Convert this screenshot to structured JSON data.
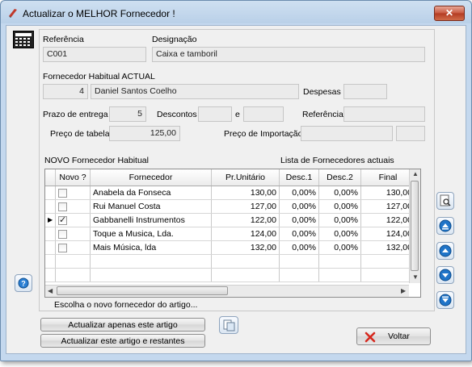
{
  "window": {
    "title": "Actualizar o MELHOR Fornecedor !",
    "close_label": "✕"
  },
  "form": {
    "referencia_label": "Referência",
    "referencia_value": "C001",
    "designacao_label": "Designação",
    "designacao_value": "Caixa e tamboril",
    "fornecedor_habitual_label": "Fornecedor Habitual ACTUAL",
    "fornecedor_num": "4",
    "fornecedor_nome": "Daniel Santos Coelho",
    "despesas_label": "Despesas",
    "despesas_value": "",
    "prazo_label": "Prazo de entrega",
    "prazo_value": "5",
    "descontos_label": "Descontos",
    "descontos_value1": "",
    "e_label": "e",
    "descontos_value2": "",
    "referencia2_label": "Referência",
    "referencia2_value": "",
    "preco_tabela_label": "Preço de tabela",
    "preco_tabela_value": "125,00",
    "preco_importacao_label": "Preço de Importação",
    "preco_importacao_value1": "",
    "preco_importacao_value2": ""
  },
  "grid": {
    "novo_label": "NOVO Fornecedor Habitual",
    "lista_label": "Lista de Fornecedores actuais",
    "headers": [
      "Novo ?",
      "Fornecedor",
      "Pr.Unitário",
      "Desc.1",
      "Desc.2",
      "Final"
    ],
    "rows": [
      {
        "checked": false,
        "fornecedor": "Anabela da Fonseca",
        "preco": "130,00",
        "desc1": "0,00%",
        "desc2": "0,00%",
        "final": "130,00"
      },
      {
        "checked": false,
        "fornecedor": "Rui Manuel Costa",
        "preco": "127,00",
        "desc1": "0,00%",
        "desc2": "0,00%",
        "final": "127,00"
      },
      {
        "checked": true,
        "fornecedor": "Gabbanelli Instrumentos",
        "preco": "122,00",
        "desc1": "0,00%",
        "desc2": "0,00%",
        "final": "122,00"
      },
      {
        "checked": false,
        "fornecedor": "Toque a Musica, Lda.",
        "preco": "124,00",
        "desc1": "0,00%",
        "desc2": "0,00%",
        "final": "124,00"
      },
      {
        "checked": false,
        "fornecedor": "Mais Música, lda",
        "preco": "132,00",
        "desc1": "0,00%",
        "desc2": "0,00%",
        "final": "132,00"
      }
    ],
    "hint": "Escolha o novo fornecedor do artigo..."
  },
  "buttons": {
    "actualizar_apenas": "Actualizar apenas este artigo",
    "actualizar_restantes": "Actualizar este artigo e restantes",
    "voltar": "Voltar"
  },
  "icons": {
    "calculator": "calculator-icon",
    "help": "help-icon",
    "preview": "preview-icon",
    "first": "first-icon",
    "prev": "prev-icon",
    "next": "next-icon",
    "last": "last-icon",
    "copy": "copy-icon",
    "cancel": "cancel-x-icon"
  }
}
